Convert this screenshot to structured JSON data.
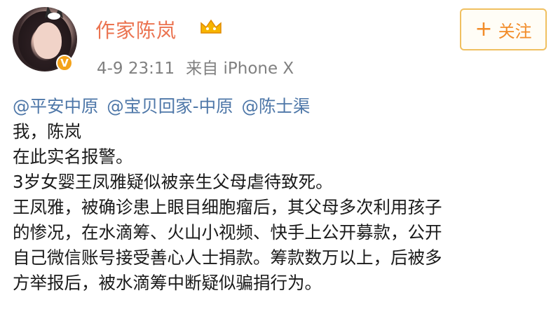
{
  "user": {
    "name": "作家陈岚",
    "verified_badge": "V",
    "timestamp": "4-9 23:11",
    "source": "来自 iPhone X"
  },
  "follow_button": {
    "plus": "+",
    "label": "关注"
  },
  "colors": {
    "username": "#eb7350",
    "mention": "#4e77a8",
    "follow": "#f28c28",
    "badge": "#f4a31b"
  },
  "post": {
    "mentions": [
      "@平安中原",
      "@宝贝回家-中原",
      "@陈士渠"
    ],
    "lines": [
      "我，陈岚",
      "在此实名报警。",
      "3岁女婴王凤雅疑似被亲生父母虐待致死。",
      "王凤雅，被确诊患上眼目细胞瘤后，其父母多次利用孩子",
      "的惨况，在水滴筹、火山小视频、快手上公开募款，公开",
      "自己微信账号接受善心人士捐款。筹款数万以上，后被多",
      "方举报后，被水滴筹中断疑似骗捐行为。"
    ]
  },
  "icons": {
    "avatar": "user-avatar",
    "vip": "vip-crown-icon"
  }
}
